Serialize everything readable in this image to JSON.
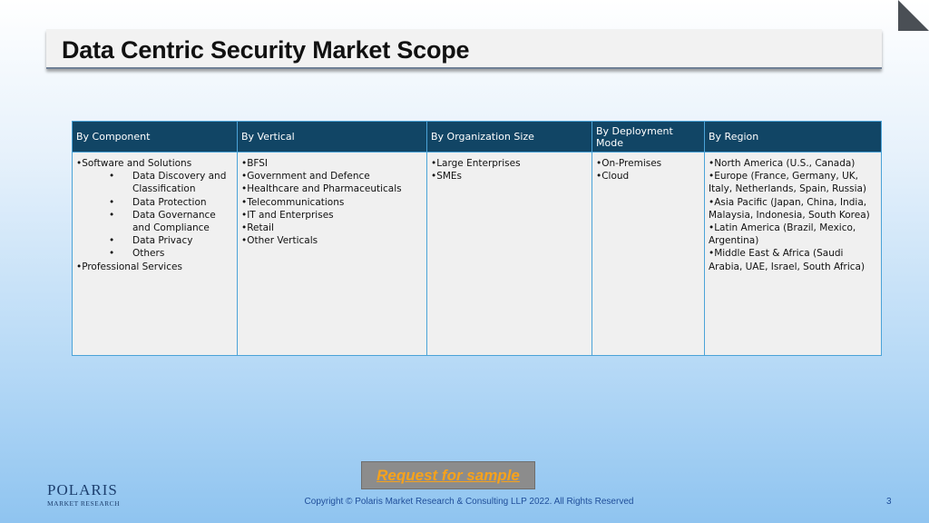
{
  "slide": {
    "title": "Data Centric Security Market Scope",
    "request_sample": "Request for sample",
    "copyright": "Copyright © Polaris Market Research & Consulting LLP 2022. All Rights Reserved",
    "page_number": "3"
  },
  "logo": {
    "name": "POLARIS",
    "tagline": "MARKET RESEARCH"
  },
  "table": {
    "headers": [
      "By Component",
      "By Vertical",
      "By Organization Size",
      "By Deployment Mode",
      "By Region"
    ],
    "component": {
      "item1": "Software and Solutions",
      "subitems": [
        "Data Discovery and Classification",
        "Data Protection",
        "Data Governance and Compliance",
        "Data Privacy",
        "Others"
      ],
      "item2": "Professional Services"
    },
    "vertical": [
      "BFSI",
      "Government and Defence",
      "Healthcare and Pharmaceuticals",
      "Telecommunications",
      "IT and Enterprises",
      "Retail",
      "Other Verticals"
    ],
    "organization_size": [
      "Large Enterprises",
      "SMEs"
    ],
    "deployment_mode": [
      "On-Premises",
      "Cloud"
    ],
    "region": [
      "North America (U.S., Canada)",
      "Europe (France, Germany, UK, Italy, Netherlands, Spain, Russia)",
      "Asia Pacific (Japan, China, India, Malaysia, Indonesia, South Korea)",
      "Latin America (Brazil, Mexico, Argentina)",
      "Middle East & Africa (Saudi Arabia, UAE, Israel, South Africa)"
    ]
  },
  "colors": {
    "header_bg": "#114565",
    "cell_bg": "#f0f0f0",
    "grid_line": "#4ba3d8",
    "accent_orange": "#f7a21b",
    "footer_blue": "#1f4e9a"
  }
}
